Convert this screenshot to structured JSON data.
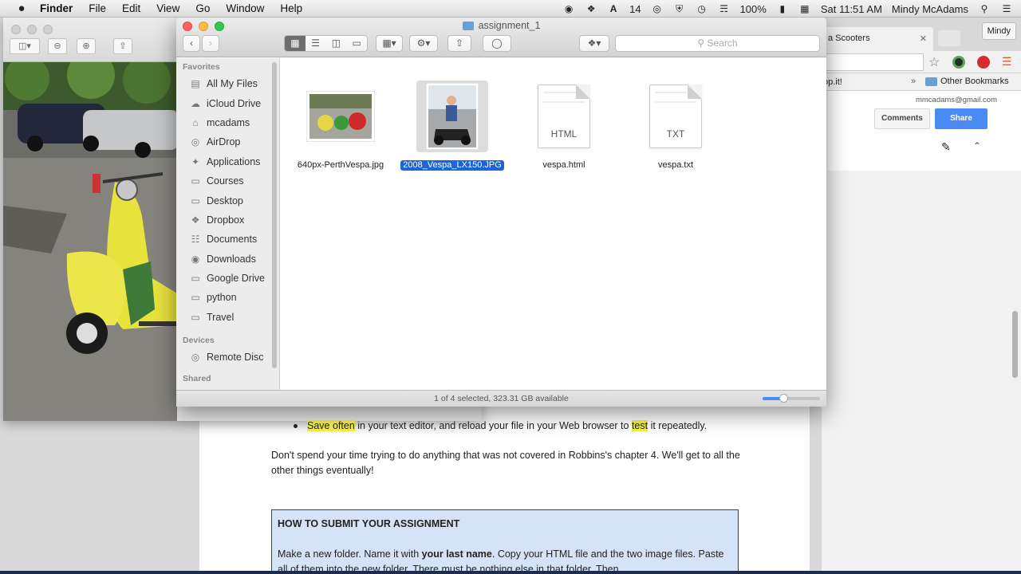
{
  "menubar": {
    "apple": "",
    "items": [
      "Finder",
      "File",
      "Edit",
      "View",
      "Go",
      "Window",
      "Help"
    ],
    "status_number": "14",
    "battery": "100%",
    "clock": "Sat 11:51 AM",
    "user": "Mindy McAdams"
  },
  "browser": {
    "tab_title": "a Scooters",
    "profile": "Mindy",
    "bookmark_partial": "op.it!",
    "other_bookmarks": "Other Bookmarks",
    "account_email": "mmcadams@gmail.com",
    "comments_label": "Comments",
    "share_label": "Share"
  },
  "finder": {
    "title": "assignment_1",
    "search_placeholder": "Search",
    "favorites_header": "Favorites",
    "favorites": [
      {
        "label": "All My Files",
        "icon": "all-files-icon"
      },
      {
        "label": "iCloud Drive",
        "icon": "cloud-icon"
      },
      {
        "label": "mcadams",
        "icon": "home-icon"
      },
      {
        "label": "AirDrop",
        "icon": "airdrop-icon"
      },
      {
        "label": "Applications",
        "icon": "applications-icon"
      },
      {
        "label": "Courses",
        "icon": "folder-icon"
      },
      {
        "label": "Desktop",
        "icon": "desktop-icon"
      },
      {
        "label": "Dropbox",
        "icon": "dropbox-icon"
      },
      {
        "label": "Documents",
        "icon": "documents-icon"
      },
      {
        "label": "Downloads",
        "icon": "downloads-icon"
      },
      {
        "label": "Google Drive",
        "icon": "folder-icon"
      },
      {
        "label": "python",
        "icon": "folder-icon"
      },
      {
        "label": "Travel",
        "icon": "folder-icon"
      }
    ],
    "devices_header": "Devices",
    "devices": [
      {
        "label": "Remote Disc",
        "icon": "disc-icon"
      }
    ],
    "shared_header": "Shared",
    "files": [
      {
        "name": "640px-PerthVespa.jpg",
        "kind": "image",
        "selected": false
      },
      {
        "name": "2008_Vespa_LX150.JPG",
        "kind": "image",
        "selected": true
      },
      {
        "name": "vespa.html",
        "kind": "HTML",
        "selected": false
      },
      {
        "name": "vespa.txt",
        "kind": "TXT",
        "selected": false
      }
    ],
    "status": "1 of 4 selected, 323.31 GB available",
    "icon_size_level": 0.36
  },
  "document": {
    "bullet_highlight1": "Save often",
    "bullet_middle": " in your text editor, and reload your file in your Web browser to ",
    "bullet_highlight2": "test",
    "bullet_end": " it repeatedly.",
    "para": "Don't spend your time trying to do anything that was not covered in Robbins's chapter 4. We'll get to all the other things eventually!",
    "box_title": "HOW TO SUBMIT YOUR ASSIGNMENT",
    "box_text_1": "Make a new folder. Name it with ",
    "box_text_bold": "your last name",
    "box_text_2": ". Copy your HTML file and the two image files. Paste all of them into the new folder. There must be nothing else in that folder. Then"
  }
}
